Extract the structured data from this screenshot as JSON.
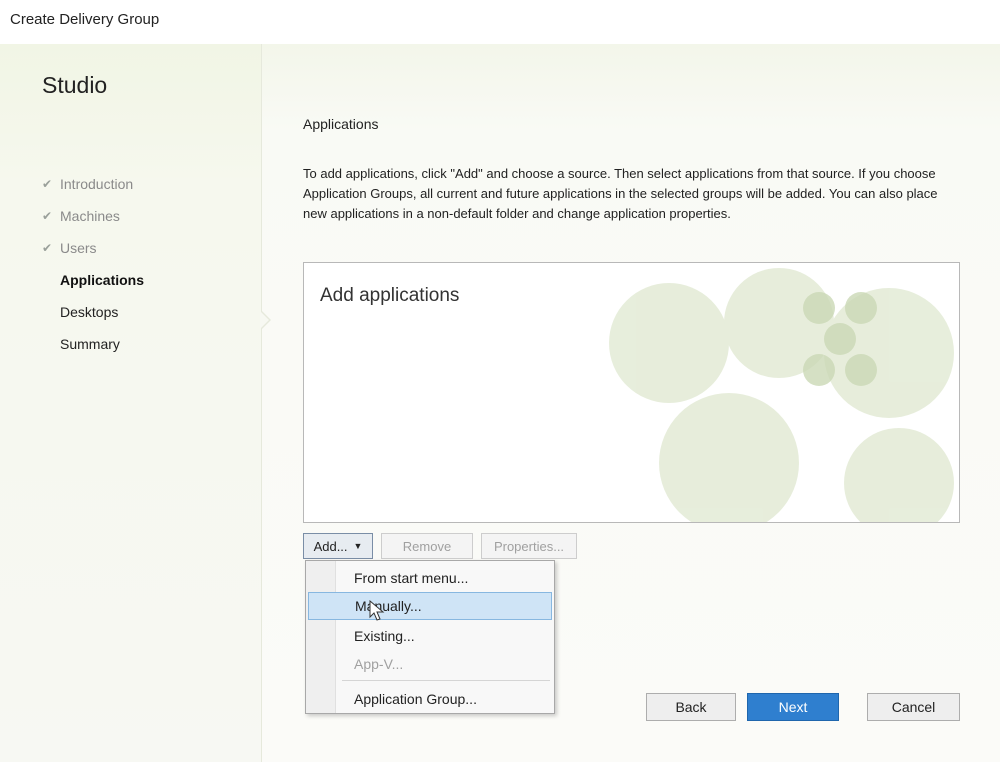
{
  "window": {
    "title": "Create Delivery Group"
  },
  "sidebar": {
    "brand": "Studio",
    "steps": [
      {
        "label": "Introduction",
        "state": "done"
      },
      {
        "label": "Machines",
        "state": "done"
      },
      {
        "label": "Users",
        "state": "done"
      },
      {
        "label": "Applications",
        "state": "active"
      },
      {
        "label": "Desktops",
        "state": "pending"
      },
      {
        "label": "Summary",
        "state": "pending"
      }
    ],
    "check_glyph": "✔"
  },
  "main": {
    "section_title": "Applications",
    "description": "To add applications, click \"Add\" and choose a source. Then select applications from that source. If you choose Application Groups, all current and future applications in the selected groups will be added. You can also place new applications in a non-default folder and change application properties.",
    "app_list": {
      "placeholder": "Add applications"
    },
    "buttons": {
      "add": "Add...",
      "remove": "Remove",
      "properties": "Properties..."
    },
    "add_menu": {
      "items": [
        {
          "label": "From start menu...",
          "state": "normal"
        },
        {
          "label": "Manually...",
          "state": "highlight"
        },
        {
          "label": "Existing...",
          "state": "normal"
        },
        {
          "label": "App-V...",
          "state": "disabled"
        },
        {
          "label": "Application Group...",
          "state": "normal"
        }
      ]
    }
  },
  "footer": {
    "back": "Back",
    "next": "Next",
    "cancel": "Cancel"
  },
  "colors": {
    "accent": "#2f7fcf",
    "menu_highlight": "#cfe4f6",
    "watermark": "#dfe8d0"
  }
}
